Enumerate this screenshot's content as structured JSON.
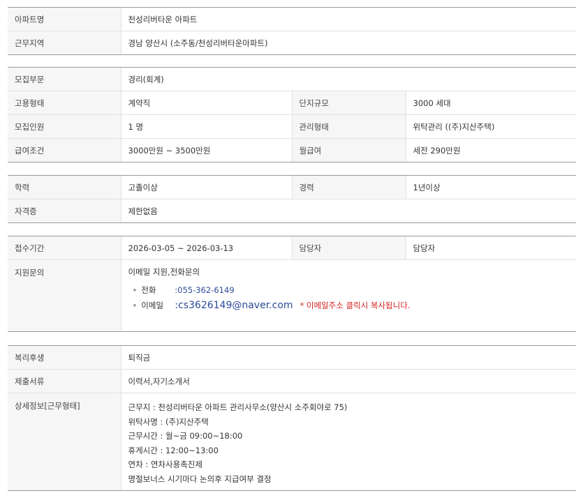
{
  "s1": [
    {
      "label": "아파트명",
      "value": "천성리버타운 아파트"
    },
    {
      "label": "근무지역",
      "value": "경남  양산시 (소주동/천성리버타운아파트)"
    }
  ],
  "s2": {
    "department": {
      "label": "모집부문",
      "value": "경리(회계)"
    },
    "employment_type": {
      "label": "고용형태",
      "value": "계약직",
      "label2": "단지규모",
      "value2": "3000 세대"
    },
    "headcount": {
      "label": "모집인원",
      "value": "1 명",
      "label2": "관리형태",
      "value2": "위탁관리 ((주)지산주택)"
    },
    "salary": {
      "label": "급여조건",
      "value": "3000만원 ~ 3500만원",
      "label2": "월급여",
      "value2": "세전 290만원"
    }
  },
  "s3": {
    "education": {
      "label": "학력",
      "value": "고졸이상",
      "label2": "경력",
      "value2": "1년이상"
    },
    "license": {
      "label": "자격증",
      "value": "제한없음"
    }
  },
  "s4": {
    "period": {
      "label": "접수기간",
      "value": "2026-03-05 ~ 2026-03-13",
      "label2": "담당자",
      "value2": "담당자"
    },
    "inquiry": {
      "label": "지원문의",
      "method": "이메일 지원,전화문의",
      "phone_label": "전화",
      "phone": ":055-362-6149",
      "email_label": "이메일",
      "email": ":cs3626149@naver.com",
      "email_note": "* 이메일주소 클릭시 복사됩니다."
    }
  },
  "s5": {
    "welfare": {
      "label": "복리후생",
      "value": "퇴직금"
    },
    "documents": {
      "label": "제출서류",
      "value": "이력서,자기소개서"
    },
    "detail": {
      "label": "상세정보[근무형태]",
      "lines": [
        "근무지 : 천성리버타운 아파트 관리사무소(양산시 소주회야로 75)",
        "위탁사명 : (주)지산주택",
        "근무시간 : 월~금 09:00~18:00",
        "휴게시간 : 12:00~13:00",
        "연차 : 연차사용촉진제",
        "명절보너스 시기마다 논의후 지급여부 결정"
      ]
    }
  },
  "colors": {
    "header_bg": "#f6f6f6",
    "link_blue": "#2b4a9a",
    "note_red": "#d42020",
    "rule": "#999999"
  }
}
